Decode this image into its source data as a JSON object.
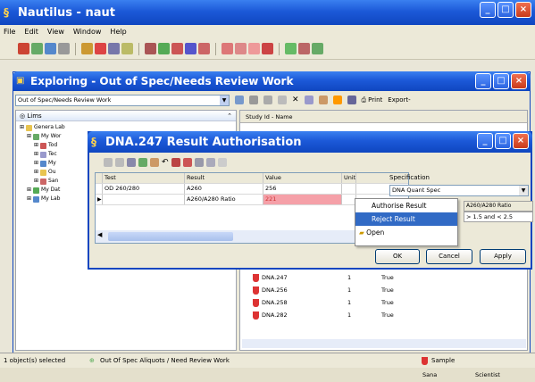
{
  "app": {
    "title": "Nautilus - naut",
    "menu": [
      "File",
      "Edit",
      "View",
      "Window",
      "Help"
    ]
  },
  "explorer": {
    "title": "Exploring - Out of Spec/Needs Review Work",
    "combo_value": "Out of Spec/Needs Review Work",
    "toolbar_print": "Print",
    "toolbar_export": "Export-",
    "tree_header": "Lims",
    "tree": [
      {
        "label": "Genera Lab",
        "indent": 0
      },
      {
        "label": "My Wor",
        "indent": 1
      },
      {
        "label": "Tod",
        "indent": 2
      },
      {
        "label": "Tec",
        "indent": 2
      },
      {
        "label": "My",
        "indent": 2
      },
      {
        "label": "Ou",
        "indent": 2
      },
      {
        "label": "San",
        "indent": 2
      },
      {
        "label": "My Dat",
        "indent": 1
      },
      {
        "label": "My Lab",
        "indent": 1
      }
    ],
    "right_header_col1": "Study Id - Name",
    "samples": [
      {
        "name": "DNA.247",
        "count": "1",
        "flag": "True"
      },
      {
        "name": "DNA.256",
        "count": "1",
        "flag": "True"
      },
      {
        "name": "DNA.258",
        "count": "1",
        "flag": "True"
      },
      {
        "name": "DNA.282",
        "count": "1",
        "flag": "True"
      }
    ]
  },
  "status": {
    "left": "1 object(s) selected",
    "middle": "Out Of Spec Aliquots / Need Review Work",
    "right": "Sample",
    "bottom_mid": "Sana",
    "bottom_right": "Scientist"
  },
  "dialog": {
    "title": "DNA.247 Result Authorisation",
    "columns": [
      "Test",
      "Result",
      "Value",
      "Unit"
    ],
    "rows": [
      {
        "marker": "",
        "test": "OD 260/280",
        "result": "A260",
        "value": "256",
        "unit": ""
      },
      {
        "marker": "▶",
        "test": "",
        "result": "A260/A280 Ratio",
        "value": "221",
        "unit": ""
      }
    ],
    "spec_label": "Specification",
    "spec_value": "DNA Quant Spec",
    "spec_header": "A260/A280 Ratio",
    "spec_range": "> 1.5 and < 2.5",
    "ok_label": "OK",
    "cancel_label": "Cancel",
    "apply_label": "Apply"
  },
  "context_menu": {
    "items": [
      "Authorise Result",
      "Reject Result",
      "Open"
    ],
    "selected_index": 1
  },
  "colors": {
    "titlebar": "#1c59d8",
    "highlight": "#316ac5",
    "out_of_spec": "#f5a0a8",
    "flask": "#dd3333"
  }
}
